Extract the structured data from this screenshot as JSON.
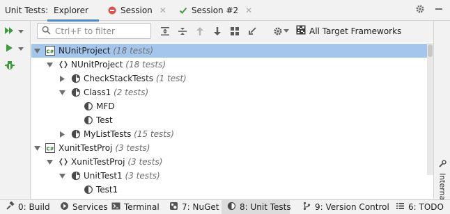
{
  "header": {
    "tool_title": "Unit Tests:",
    "tabs": [
      {
        "label": "Explorer",
        "active": true
      },
      {
        "label": "Session",
        "icon": "error-stop-icon"
      },
      {
        "label": "Session #2",
        "icon": "checkmark-icon"
      }
    ]
  },
  "toolbar": {
    "search_placeholder": "Ctrl+F to filter",
    "framework_label": "All Target Frameworks"
  },
  "tree": [
    {
      "label": "NUnitProject",
      "count": "(18 tests)",
      "icon": "csharp-project-icon",
      "expanded": true,
      "selected": true
    },
    {
      "label": "NUnitProject",
      "count": "(18 tests)",
      "icon": "namespace-icon",
      "expanded": true
    },
    {
      "label": "CheckStackTests",
      "count": "(1 test)",
      "icon": "test-class-icon",
      "expanded": false
    },
    {
      "label": "Class1",
      "count": "(2 tests)",
      "icon": "test-class-icon",
      "expanded": true
    },
    {
      "label": "MFD",
      "count": "",
      "icon": "test-method-icon"
    },
    {
      "label": "Test",
      "count": "",
      "icon": "test-method-icon"
    },
    {
      "label": "MyListTests",
      "count": "(15 tests)",
      "icon": "test-class-icon",
      "expanded": false
    },
    {
      "label": "XunitTestProj",
      "count": "(3 tests)",
      "icon": "csharp-project-icon",
      "expanded": true
    },
    {
      "label": "XunitTestProj",
      "count": "(3 tests)",
      "icon": "namespace-icon",
      "expanded": true
    },
    {
      "label": "UnitTest1",
      "count": "(3 tests)",
      "icon": "test-class-icon",
      "expanded": true
    },
    {
      "label": "Test1",
      "count": "",
      "icon": "test-method-icon"
    }
  ],
  "side_panel": {
    "label": "Internal"
  },
  "statusbar": [
    {
      "label": "0: Build",
      "mnemonic": "0",
      "icon": "build-icon"
    },
    {
      "label": "Services",
      "icon": "services-icon"
    },
    {
      "label": "Terminal",
      "icon": "terminal-icon"
    },
    {
      "label": "7: NuGet",
      "mnemonic": "7",
      "icon": "nuget-icon"
    },
    {
      "label": "8: Unit Tests",
      "mnemonic": "8",
      "icon": "unit-tests-icon",
      "active": true
    },
    {
      "label": "9: Version Control",
      "mnemonic": "9",
      "icon": "version-control-icon"
    },
    {
      "label": "6: TODO",
      "mnemonic": "6",
      "icon": "todo-icon"
    }
  ],
  "colors": {
    "accent": "#4a88c7",
    "selection": "#a5c6ec",
    "run_green": "#3e9b3e",
    "error_red": "#d9534f"
  }
}
